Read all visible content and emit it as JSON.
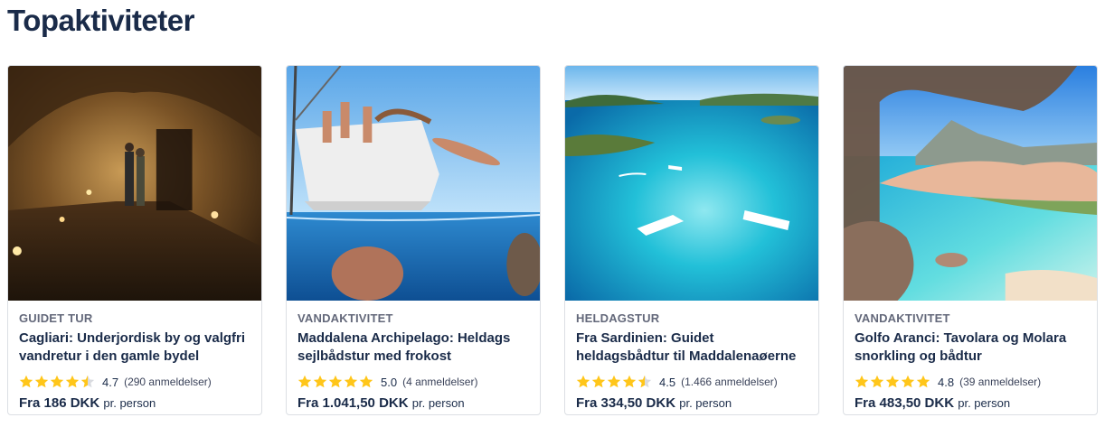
{
  "section": {
    "title": "Topaktiviteter"
  },
  "colors": {
    "star": "#ffc61a",
    "star_empty": "#d9dbe0",
    "text": "#1a2b49"
  },
  "cards": [
    {
      "image": "underground-cave-tunnel",
      "category": "GUIDET TUR",
      "title": "Cagliari: Underjordisk by og valgfri vandretur i den gamle bydel",
      "rating": 4.7,
      "rating_text": "4.7",
      "reviews": "(290 anmeldelser)",
      "price": "Fra 186 DKK",
      "unit": "pr. person"
    },
    {
      "image": "sailboat-swimmers",
      "category": "VANDAKTIVITET",
      "title": "Maddalena Archipelago: Heldags sejlbådstur med frokost",
      "rating": 5.0,
      "rating_text": "5.0",
      "reviews": "(4 anmeldelser)",
      "price": "Fra 1.041,50 DKK",
      "unit": "pr. person"
    },
    {
      "image": "turquoise-sea-boats",
      "category": "HELDAGSTUR",
      "title": "Fra Sardinien: Guidet heldagsbådtur til Maddalenaøerne",
      "rating": 4.5,
      "rating_text": "4.5",
      "reviews": "(1.466 anmeldelser)",
      "price": "Fra 334,50 DKK",
      "unit": "pr. person"
    },
    {
      "image": "tavolara-beach-cliffs",
      "category": "VANDAKTIVITET",
      "title": "Golfo Aranci: Tavolara og Molara snorkling og bådtur",
      "rating": 4.8,
      "rating_text": "4.8",
      "reviews": "(39 anmeldelser)",
      "price": "Fra 483,50 DKK",
      "unit": "pr. person"
    }
  ]
}
